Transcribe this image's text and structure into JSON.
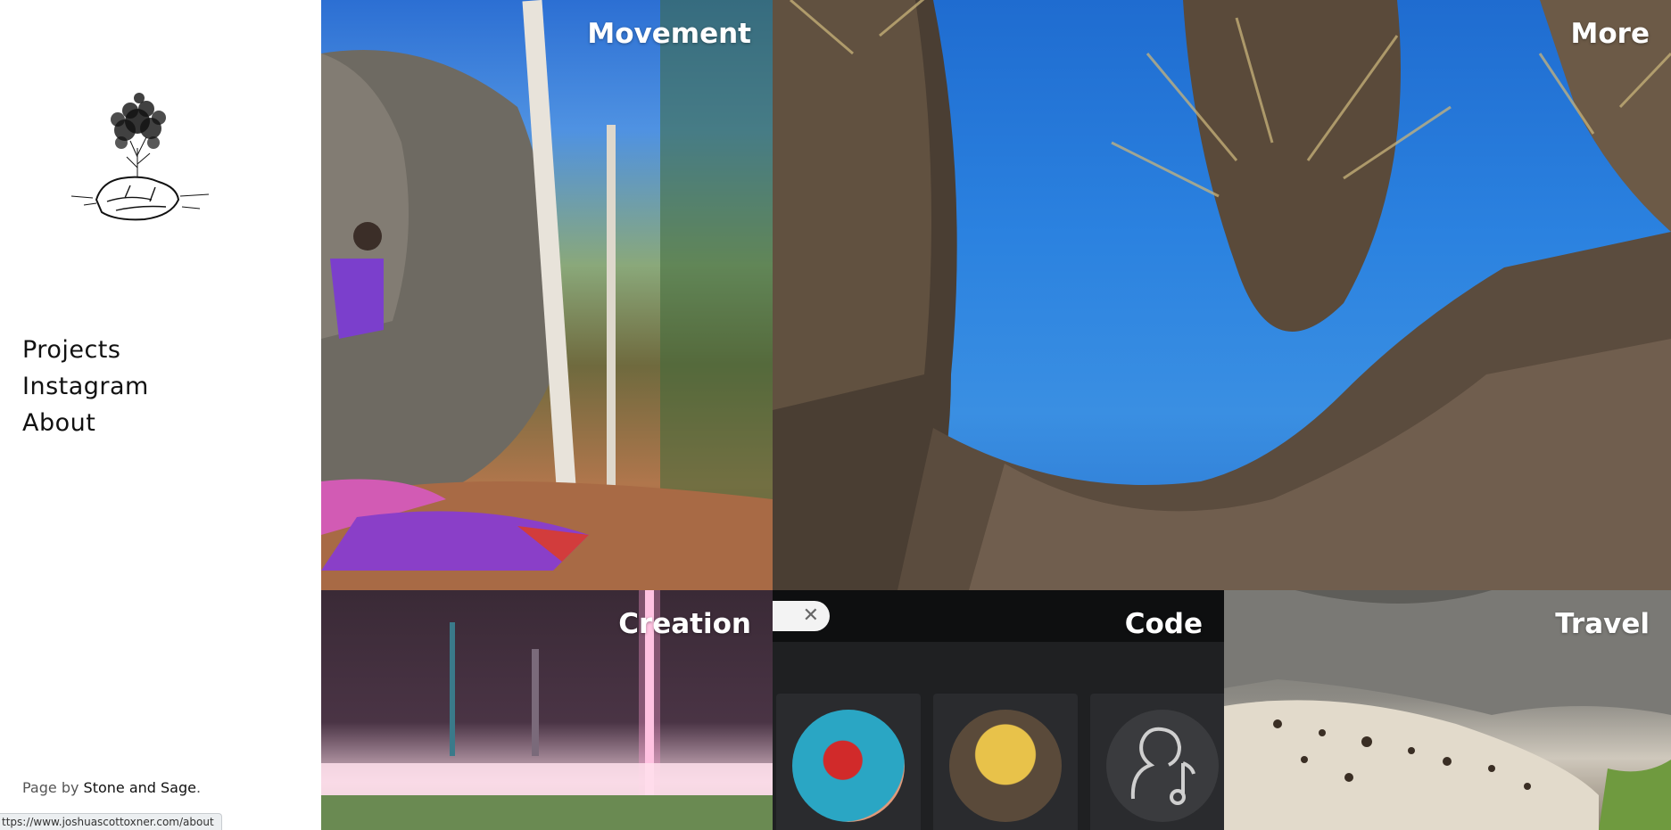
{
  "nav": {
    "items": [
      {
        "label": "Projects"
      },
      {
        "label": "Instagram"
      },
      {
        "label": "About"
      }
    ]
  },
  "credit": {
    "prefix": "Page by",
    "author": "Stone and Sage",
    "suffix": "."
  },
  "status_url": "ttps://www.joshuascottoxner.com/about",
  "tiles": [
    {
      "title": "Movement"
    },
    {
      "title": "More"
    },
    {
      "title": "Creation"
    },
    {
      "title": "Code"
    },
    {
      "title": "Travel"
    }
  ]
}
